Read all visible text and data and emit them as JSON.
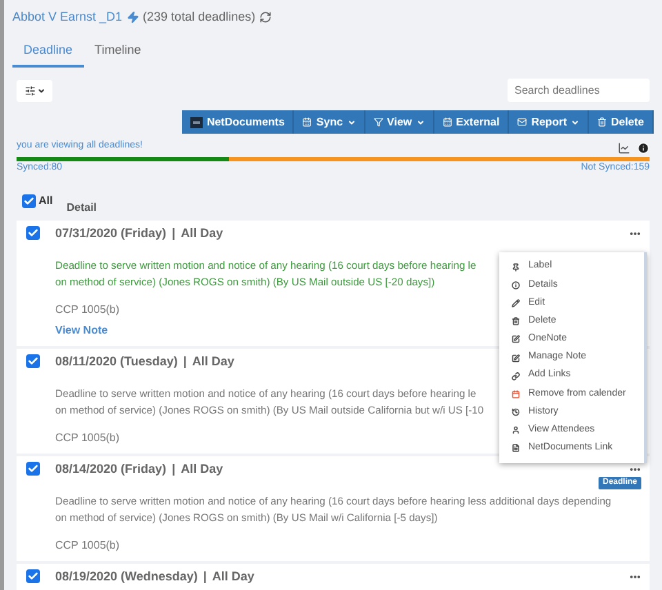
{
  "header": {
    "case_title": "Abbot V Earnst _D1",
    "total": "(239 total deadlines)"
  },
  "tabs": [
    {
      "label": "Deadline",
      "selected": true
    },
    {
      "label": "Timeline",
      "selected": false
    }
  ],
  "search": {
    "placeholder": "Search deadlines"
  },
  "toolbar": [
    {
      "label": "NetDocuments",
      "dropdown": false
    },
    {
      "label": "Sync",
      "dropdown": true
    },
    {
      "label": "View",
      "dropdown": true
    },
    {
      "label": "External",
      "dropdown": false
    },
    {
      "label": "Report",
      "dropdown": true
    },
    {
      "label": "Delete",
      "dropdown": false
    }
  ],
  "viewing_message": "you are viewing all deadlines!",
  "sync": {
    "level": 0.335,
    "synced": "Synced:80",
    "not_synced": "Not Synced:159"
  },
  "select_all": {
    "label": "All",
    "checked": true
  },
  "column": "Detail",
  "deadlines": [
    {
      "checked": true,
      "date": "07/31/2020 (Friday)",
      "separator": "|",
      "time": "All Day",
      "actions_visible": true,
      "highlighted": true,
      "lines": [
        "Deadline to serve written motion and notice of any hearing (16 court days before hearing le",
        "on method of service) (Jones ROGS on smith) (By US Mail outside US [-20 days])"
      ],
      "code": "CCP 1005(b)",
      "note_link": "View Note"
    },
    {
      "checked": true,
      "date": "08/11/2020 (Tuesday)",
      "separator": "|",
      "time": "All Day",
      "actions_visible": false,
      "highlighted": false,
      "lines": [
        "Deadline to serve written motion and notice of any hearing (16 court days before hearing le",
        "on method of service) (Jones ROGS on smith) (By US Mail outside California but w/i US [-10"
      ],
      "code": "CCP 1005(b)"
    },
    {
      "checked": true,
      "date": "08/14/2020 (Friday)",
      "separator": "|",
      "time": "All Day",
      "actions_visible": true,
      "highlighted": false,
      "badge": "Deadline",
      "lines": [
        "Deadline to serve written motion and notice of any hearing (16 court days before hearing less additional days depending",
        "on method of service) (Jones ROGS on smith) (By US Mail w/i California [-5 days])"
      ],
      "code": "CCP 1005(b)"
    },
    {
      "checked": true,
      "date": "08/19/2020 (Wednesday)",
      "separator": "|",
      "time": "All Day",
      "actions_visible": true
    }
  ],
  "menu": [
    {
      "label": "Label"
    },
    {
      "label": "Details"
    },
    {
      "label": "Edit"
    },
    {
      "label": "Delete"
    },
    {
      "label": "OneNote"
    },
    {
      "label": "Manage Note"
    },
    {
      "label": "Add Links"
    },
    {
      "label": "Remove from calender"
    },
    {
      "label": "History"
    },
    {
      "label": "View Attendees"
    },
    {
      "label": "NetDocuments Link"
    }
  ]
}
